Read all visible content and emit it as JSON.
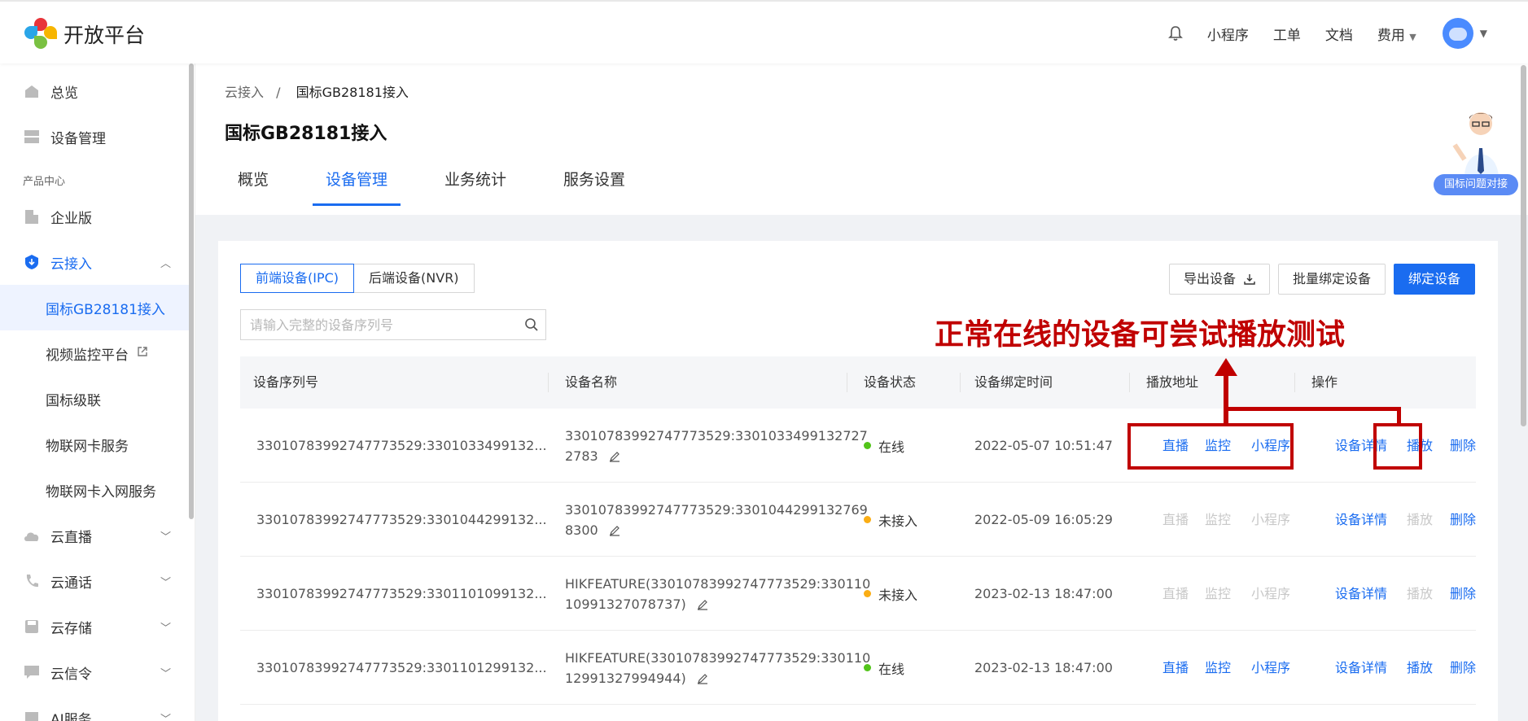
{
  "brand": {
    "name": "开放平台"
  },
  "topnav": {
    "items": [
      "小程序",
      "工单",
      "文档",
      "费用"
    ]
  },
  "sidebar": {
    "overview": "总览",
    "device_mgmt": "设备管理",
    "section": "产品中心",
    "enterprise": "企业版",
    "cloud_access": "云接入",
    "sub": [
      "国标GB28181接入",
      "视频监控平台",
      "国标级联",
      "物联网卡服务",
      "物联网卡入网服务"
    ],
    "cloud_live": "云直播",
    "cloud_call": "云通话",
    "cloud_storage": "云存储",
    "cloud_signal": "云信令",
    "ai": "AI服务"
  },
  "breadcrumb": {
    "parent": "云接入",
    "sep": "/",
    "current": "国标GB28181接入"
  },
  "page_title": "国标GB28181接入",
  "tabs": [
    "概览",
    "设备管理",
    "业务统计",
    "服务设置"
  ],
  "helper": {
    "label": "国标问题对接"
  },
  "segment": {
    "front": "前端设备(IPC)",
    "back": "后端设备(NVR)"
  },
  "actions": {
    "export": "导出设备",
    "batch_bind": "批量绑定设备",
    "bind": "绑定设备"
  },
  "search": {
    "placeholder": "请输入完整的设备序列号"
  },
  "annotation": "正常在线的设备可尝试播放测试",
  "table": {
    "headers": [
      "设备序列号",
      "设备名称",
      "设备状态",
      "设备绑定时间",
      "播放地址",
      "操作"
    ],
    "rows": [
      {
        "serial": "33010783992747773529:3301033499132...",
        "name1": "33010783992747773529:3301033499132727",
        "name2": "2783",
        "status": "在线",
        "status_color": "#52c41a",
        "time": "2022-05-07 10:51:47",
        "live": "直播",
        "monitor": "监控",
        "mini": "小程序",
        "detail": "设备详情",
        "play": "播放",
        "del": "删除",
        "enabled": true
      },
      {
        "serial": "33010783992747773529:3301044299132...",
        "name1": "33010783992747773529:3301044299132769",
        "name2": "8300",
        "status": "未接入",
        "status_color": "#faad14",
        "time": "2022-05-09 16:05:29",
        "live": "直播",
        "monitor": "监控",
        "mini": "小程序",
        "detail": "设备详情",
        "play": "播放",
        "del": "删除",
        "enabled": false
      },
      {
        "serial": "33010783992747773529:3301101099132...",
        "name1": "HIKFEATURE(33010783992747773529:330110",
        "name2": "10991327078737)",
        "status": "未接入",
        "status_color": "#faad14",
        "time": "2023-02-13 18:47:00",
        "live": "直播",
        "monitor": "监控",
        "mini": "小程序",
        "detail": "设备详情",
        "play": "播放",
        "del": "删除",
        "enabled": false
      },
      {
        "serial": "33010783992747773529:3301101299132...",
        "name1": "HIKFEATURE(33010783992747773529:330110",
        "name2": "12991327994944)",
        "status": "在线",
        "status_color": "#52c41a",
        "time": "2023-02-13 18:47:00",
        "live": "直播",
        "monitor": "监控",
        "mini": "小程序",
        "detail": "设备详情",
        "play": "播放",
        "del": "删除",
        "enabled": true
      }
    ]
  },
  "colors": {
    "accent": "#1a6cf0",
    "annotation": "#c00000"
  }
}
